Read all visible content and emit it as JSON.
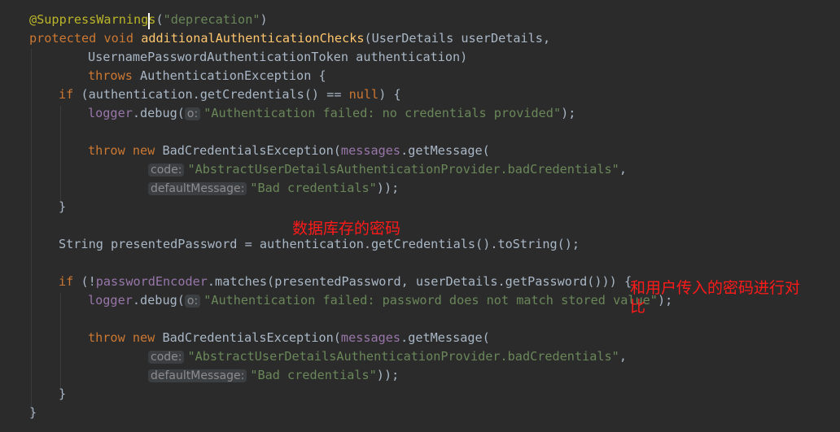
{
  "code": {
    "l1": {
      "annotation": "@SuppressWarnings",
      "paren_open": "(",
      "arg": "\"deprecation\"",
      "paren_close": ")"
    },
    "l2": {
      "kw_protected": "protected",
      "kw_void": "void",
      "method": "additionalAuthenticationChecks",
      "rest": "(UserDetails userDetails,"
    },
    "l3": {
      "text": "UsernamePasswordAuthenticationToken authentication)"
    },
    "l4": {
      "kw_throws": "throws",
      "rest": "AuthenticationException {"
    },
    "l5": {
      "kw_if": "if",
      "mid": "(authentication.getCredentials() == ",
      "kw_null": "null",
      "end": ") {"
    },
    "l6": {
      "field": "logger",
      "call": ".debug(",
      "hint": "o:",
      "string": "\"Authentication failed: no credentials provided\"",
      "end": ");"
    },
    "l8": {
      "kw_throw": "throw",
      "kw_new": "new",
      "cls": "BadCredentialsException(",
      "field": "messages",
      "call": ".getMessage("
    },
    "l9": {
      "hint": "code:",
      "string": "\"AbstractUserDetailsAuthenticationProvider.badCredentials\"",
      "end": ","
    },
    "l10": {
      "hint": "defaultMessage:",
      "string": "\"Bad credentials\"",
      "end": "));"
    },
    "l11": {
      "text": "}"
    },
    "l13": {
      "text": "String presentedPassword = authentication.getCredentials().toString();"
    },
    "l15": {
      "kw_if": "if",
      "pre": "(!",
      "field": "passwordEncoder",
      "rest": ".matches(presentedPassword, userDetails.getPassword())) {"
    },
    "l16": {
      "field": "logger",
      "call": ".debug(",
      "hint": "o:",
      "string": "\"Authentication failed: password does not match stored value\"",
      "end": ");"
    },
    "l18": {
      "kw_throw": "throw",
      "kw_new": "new",
      "cls": "BadCredentialsException(",
      "field": "messages",
      "call": ".getMessage("
    },
    "l19": {
      "hint": "code:",
      "string": "\"AbstractUserDetailsAuthenticationProvider.badCredentials\"",
      "end": ","
    },
    "l20": {
      "hint": "defaultMessage:",
      "string": "\"Bad credentials\"",
      "end": "));"
    },
    "l21": {
      "text": "}"
    },
    "l22": {
      "text": "}"
    }
  },
  "annotations": {
    "db_password": "数据库存的密码",
    "compare_line1": "和用户传入的密码进行对",
    "compare_line2": "比"
  },
  "colors": {
    "background": "#2b2b2b",
    "annotation_text": "#ff1a1a",
    "keyword": "#cc7832",
    "method_decl": "#ffc66d",
    "string": "#6a8759",
    "field": "#9876aa",
    "java_annotation": "#bbb529",
    "default_text": "#a9b7c6"
  }
}
